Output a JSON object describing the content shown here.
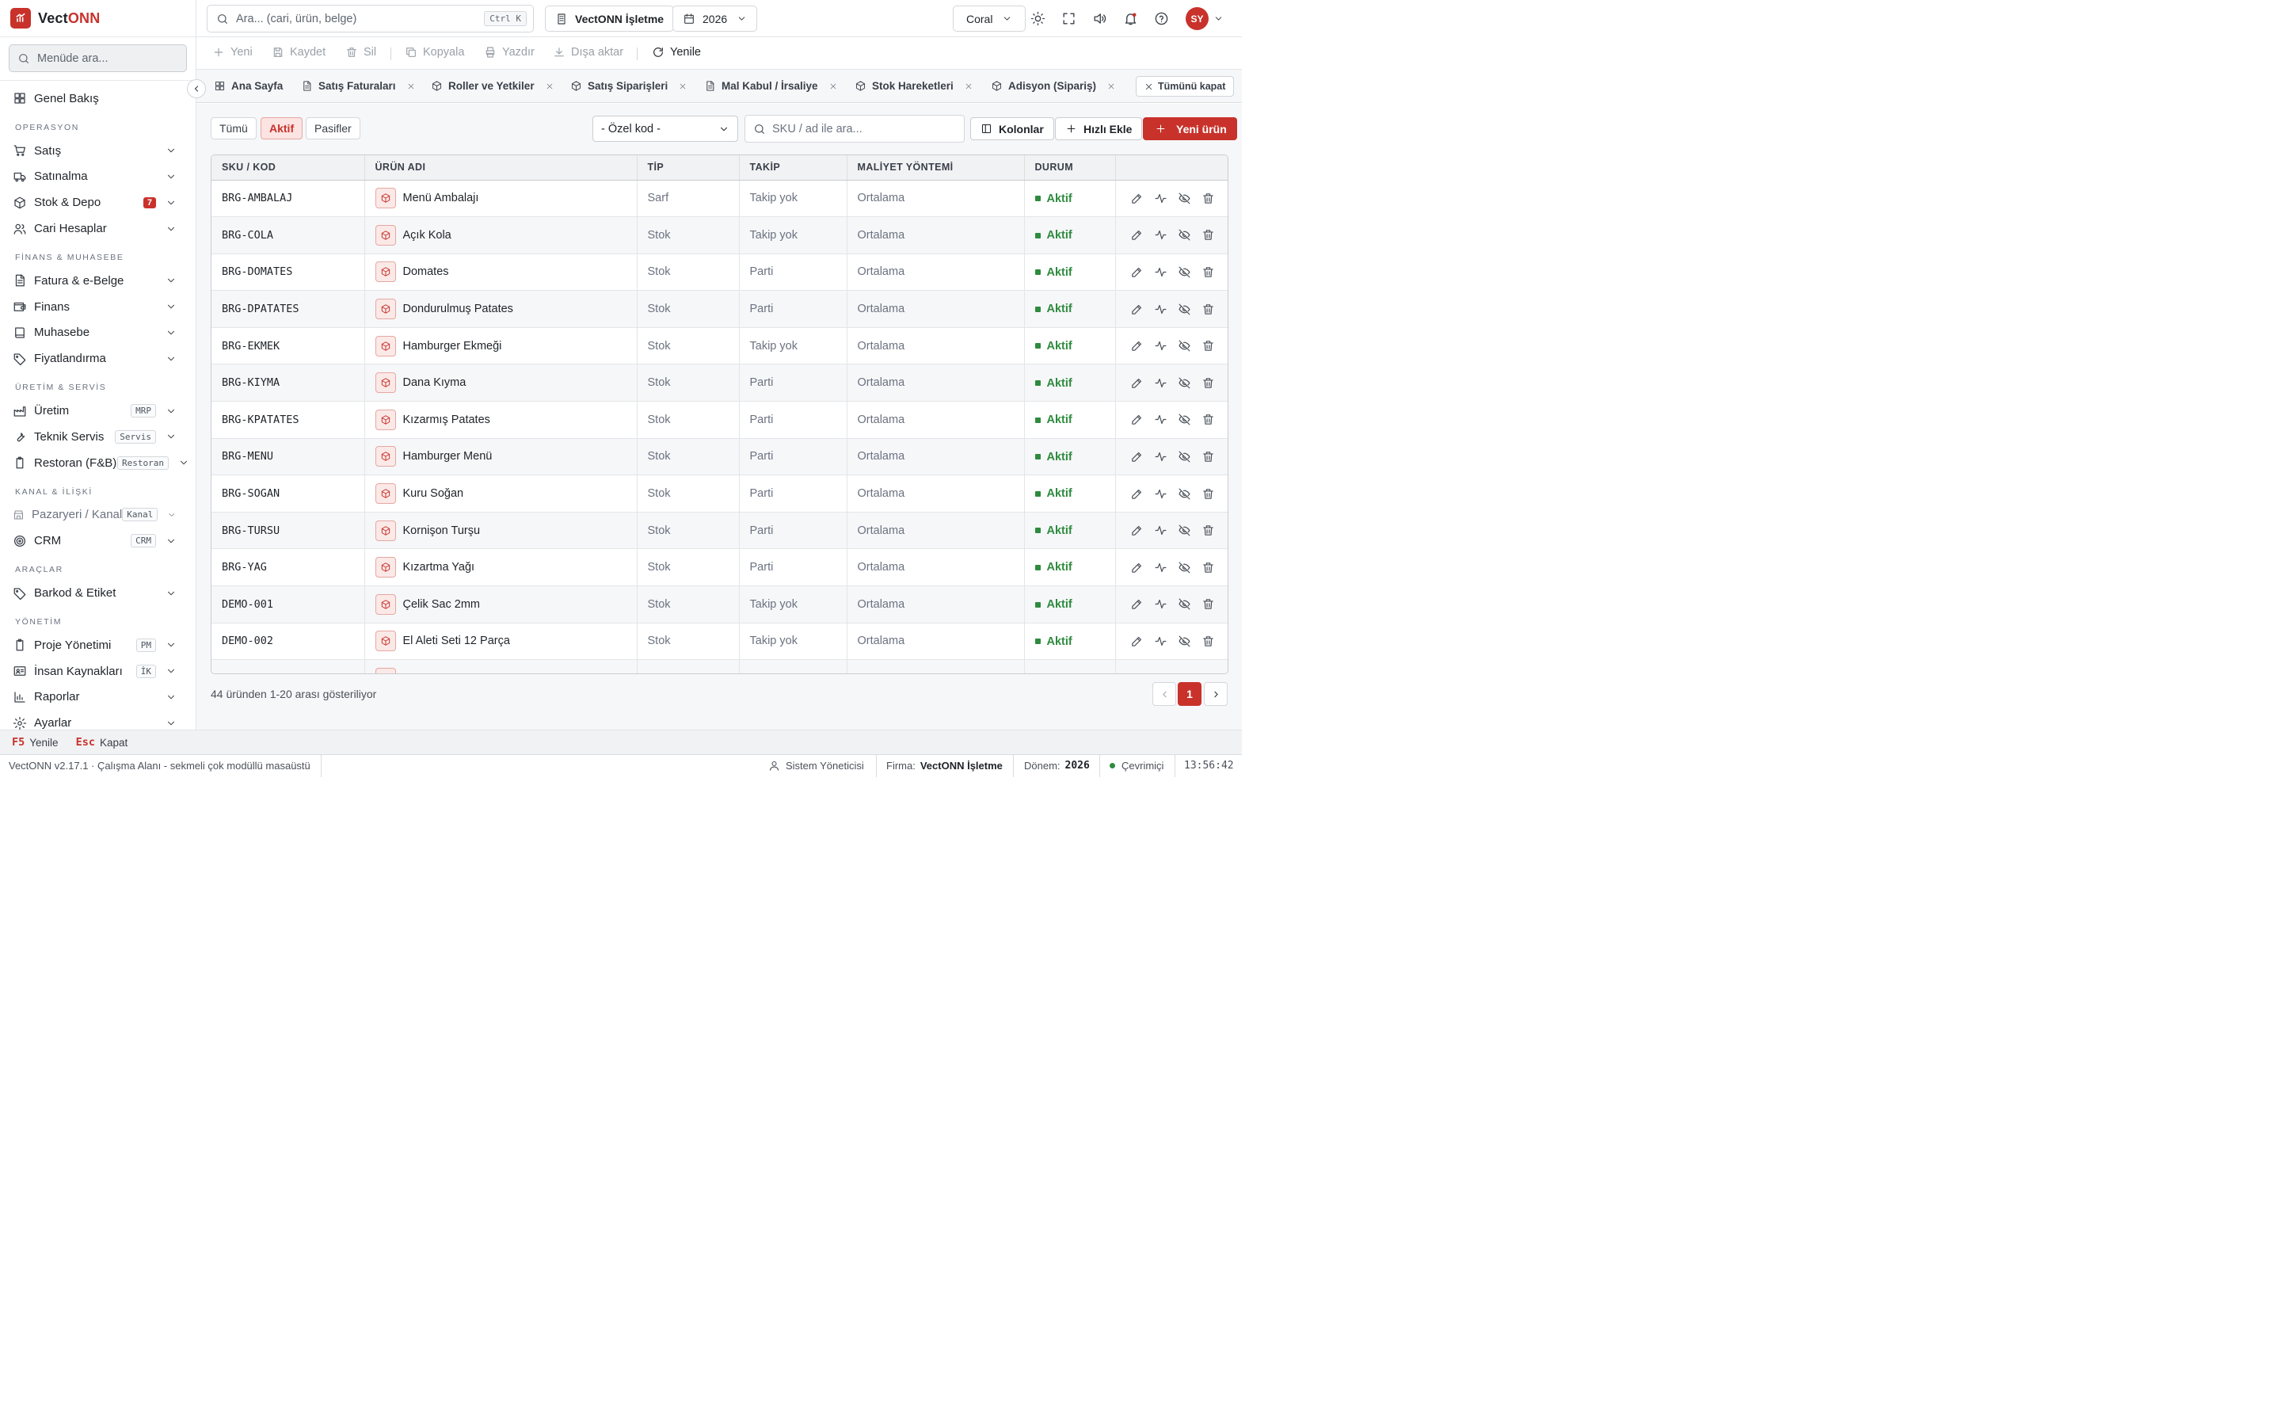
{
  "app": {
    "brand_prefix": "Vect",
    "brand_suffix": "ONN"
  },
  "sidebar": {
    "search_placeholder": "Menüde ara...",
    "overview": "Genel Bakış",
    "sections": {
      "operasyon": "OPERASYON",
      "finans": "FİNANS & MUHASEBE",
      "uretim": "ÜRETİM & SERVİS",
      "kanal": "KANAL & İLİŞKİ",
      "araclar": "ARAÇLAR",
      "yonetim": "YÖNETİM"
    },
    "items": {
      "satis": "Satış",
      "satinalma": "Satınalma",
      "stok": "Stok & Depo",
      "stok_badge": "7",
      "cari": "Cari Hesaplar",
      "fatura": "Fatura & e-Belge",
      "finans": "Finans",
      "muhasebe": "Muhasebe",
      "fiyat": "Fiyatlandırma",
      "uretim": "Üretim",
      "uretim_tag": "MRP",
      "servis": "Teknik Servis",
      "servis_tag": "Servis",
      "restoran": "Restoran (F&B)",
      "restoran_tag": "Restoran",
      "pazaryeri": "Pazaryeri / Kanal",
      "pazaryeri_tag": "Kanal",
      "crm": "CRM",
      "crm_tag": "CRM",
      "barkod": "Barkod & Etiket",
      "proje": "Proje Yönetimi",
      "proje_tag": "PM",
      "ik": "İnsan Kaynakları",
      "ik_tag": "İK",
      "raporlar": "Raporlar",
      "ayarlar": "Ayarlar"
    }
  },
  "topbar": {
    "search_placeholder": "Ara... (cari, ürün, belge)",
    "search_shortcut": "Ctrl K",
    "company": "VectONN İşletme",
    "year": "2026",
    "theme": "Coral",
    "avatar": "SY"
  },
  "actions": {
    "new": "Yeni",
    "save": "Kaydet",
    "delete": "Sil",
    "copy": "Kopyala",
    "print": "Yazdır",
    "export": "Dışa aktar",
    "refresh": "Yenile"
  },
  "tabs": [
    "Ana Sayfa",
    "Satış Faturaları",
    "Roller ve Yetkiler",
    "Satış Siparişleri",
    "Mal Kabul / İrsaliye",
    "Stok Hareketleri",
    "Adisyon (Sipariş)"
  ],
  "tabs_close_all": "Tümünü kapat",
  "filters": {
    "all": "Tümü",
    "active": "Aktif",
    "passive": "Pasifler"
  },
  "ozel_kod": "- Özel kod -",
  "sku_search_placeholder": "SKU / ad ile ara...",
  "buttons": {
    "columns": "Kolonlar",
    "quick_add": "Hızlı Ekle",
    "new_product": "Yeni ürün"
  },
  "table": {
    "headers": [
      "SKU / KOD",
      "ÜRÜN ADI",
      "TİP",
      "TAKİP",
      "MALİYET YÖNTEMİ",
      "DURUM"
    ],
    "rows": [
      {
        "sku": "BRG-AMBALAJ",
        "name": "Menü Ambalajı",
        "type": "Sarf",
        "track": "Takip yok",
        "cost": "Ortalama",
        "status": "Aktif"
      },
      {
        "sku": "BRG-COLA",
        "name": "Açık Kola",
        "type": "Stok",
        "track": "Takip yok",
        "cost": "Ortalama",
        "status": "Aktif"
      },
      {
        "sku": "BRG-DOMATES",
        "name": "Domates",
        "type": "Stok",
        "track": "Parti",
        "cost": "Ortalama",
        "status": "Aktif"
      },
      {
        "sku": "BRG-DPATATES",
        "name": "Dondurulmuş Patates",
        "type": "Stok",
        "track": "Parti",
        "cost": "Ortalama",
        "status": "Aktif"
      },
      {
        "sku": "BRG-EKMEK",
        "name": "Hamburger Ekmeği",
        "type": "Stok",
        "track": "Takip yok",
        "cost": "Ortalama",
        "status": "Aktif"
      },
      {
        "sku": "BRG-KIYMA",
        "name": "Dana Kıyma",
        "type": "Stok",
        "track": "Parti",
        "cost": "Ortalama",
        "status": "Aktif"
      },
      {
        "sku": "BRG-KPATATES",
        "name": "Kızarmış Patates",
        "type": "Stok",
        "track": "Parti",
        "cost": "Ortalama",
        "status": "Aktif"
      },
      {
        "sku": "BRG-MENU",
        "name": "Hamburger Menü",
        "type": "Stok",
        "track": "Parti",
        "cost": "Ortalama",
        "status": "Aktif"
      },
      {
        "sku": "BRG-SOGAN",
        "name": "Kuru Soğan",
        "type": "Stok",
        "track": "Parti",
        "cost": "Ortalama",
        "status": "Aktif"
      },
      {
        "sku": "BRG-TURSU",
        "name": "Kornişon Turşu",
        "type": "Stok",
        "track": "Parti",
        "cost": "Ortalama",
        "status": "Aktif"
      },
      {
        "sku": "BRG-YAG",
        "name": "Kızartma Yağı",
        "type": "Stok",
        "track": "Parti",
        "cost": "Ortalama",
        "status": "Aktif"
      },
      {
        "sku": "DEMO-001",
        "name": "Çelik Sac 2mm",
        "type": "Stok",
        "track": "Takip yok",
        "cost": "Ortalama",
        "status": "Aktif"
      },
      {
        "sku": "DEMO-002",
        "name": "El Aleti Seti 12 Parça",
        "type": "Stok",
        "track": "Takip yok",
        "cost": "Ortalama",
        "status": "Aktif"
      }
    ]
  },
  "pagination": {
    "summary": "44 üründen 1-20 arası gösteriliyor",
    "current": "1"
  },
  "hints": {
    "f5_key": "F5",
    "f5_label": "Yenile",
    "esc_key": "Esc",
    "esc_label": "Kapat"
  },
  "statusbar": {
    "version": "VectONN v2.17.1 · Çalışma Alanı - sekmeli çok modüllü masaüstü",
    "user": "Sistem Yöneticisi",
    "firm_label": "Firma:",
    "firm": "VectONN İşletme",
    "period_label": "Dönem:",
    "period": "2026",
    "online": "Çevrimiçi",
    "time": "13:56:42"
  },
  "colors": {
    "accent": "#c8322b",
    "active_green": "#2e8b3e"
  }
}
